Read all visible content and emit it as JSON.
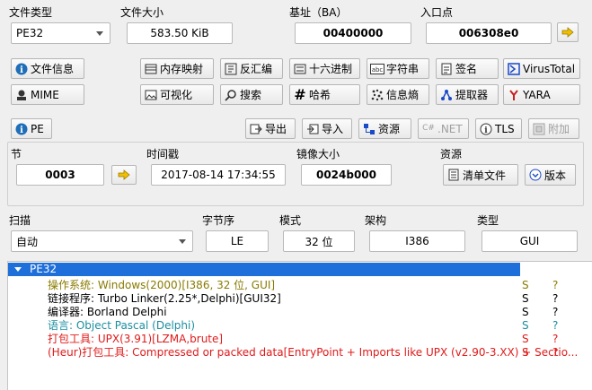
{
  "top": {
    "file_type_label": "文件类型",
    "file_type_value": "PE32",
    "file_size_label": "文件大小",
    "file_size_value": "583.50 KiB",
    "base_label": "基址（BA）",
    "base_value": "00400000",
    "entry_label": "入口点",
    "entry_value": "006308e0"
  },
  "toolbar1": {
    "file_info": "文件信息",
    "memory_map": "内存映射",
    "disasm": "反汇编",
    "hex": "十六进制",
    "strings": "字符串",
    "signatures": "签名",
    "virustotal": "VirusTotal"
  },
  "toolbar2": {
    "mime": "MIME",
    "visualize": "可视化",
    "search": "搜索",
    "hash": "哈希",
    "entropy": "信息熵",
    "extractor": "提取器",
    "yara": "YARA"
  },
  "pe_row": {
    "pe": "PE",
    "export": "导出",
    "import": "导入",
    "resources": "资源",
    "net": ".NET",
    "tls": "TLS",
    "overlay": "附加"
  },
  "info": {
    "section_label": "节",
    "section_value": "0003",
    "timestamp_label": "时间戳",
    "timestamp_value": "2017-08-14 17:34:55",
    "image_size_label": "镜像大小",
    "image_size_value": "0024b000",
    "resources_label": "资源",
    "manifest": "清单文件",
    "version": "版本"
  },
  "scan": {
    "scan_label": "扫描",
    "scan_value": "自动",
    "endian_label": "字节序",
    "endian_value": "LE",
    "mode_label": "模式",
    "mode_value": "32 位",
    "arch_label": "架构",
    "arch_value": "I386",
    "type_label": "类型",
    "type_value": "GUI"
  },
  "results": {
    "root": "PE32",
    "rows": [
      {
        "text": "操作系统: Windows(2000)[I386, 32 位, GUI]",
        "s": "S",
        "q": "?",
        "color": "#8a7a00"
      },
      {
        "text": "链接程序: Turbo Linker(2.25*,Delphi)[GUI32]",
        "s": "S",
        "q": "?",
        "color": "#000000"
      },
      {
        "text": "编译器: Borland Delphi",
        "s": "S",
        "q": "?",
        "color": "#000000"
      },
      {
        "text": "语言: Object Pascal (Delphi)",
        "s": "S",
        "q": "?",
        "color": "#1b8fa0"
      },
      {
        "text": "打包工具: UPX(3.91)[LZMA,brute]",
        "s": "S",
        "q": "?",
        "color": "#e01a1a"
      },
      {
        "text": "(Heur)打包工具: Compressed or packed data[EntryPoint + Imports like UPX (v2.90-3.XX) + Sectio...",
        "s": "S",
        "q": "?",
        "color": "#e01a1a"
      }
    ]
  }
}
